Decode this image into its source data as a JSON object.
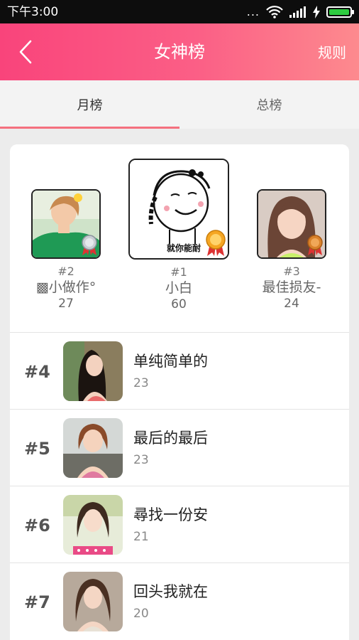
{
  "status_bar": {
    "time": "下午3:00",
    "dots": "...",
    "icons": [
      "wifi-icon",
      "signal-icon",
      "charging-icon",
      "battery-icon"
    ],
    "battery_level_percent": 100
  },
  "header": {
    "back_icon": "chevron-left-icon",
    "title": "女神榜",
    "rules_label": "规则"
  },
  "tabs": [
    {
      "label": "月榜",
      "active": true
    },
    {
      "label": "总榜",
      "active": false
    }
  ],
  "podium": [
    {
      "rank": "#2",
      "name": "▩小做作°",
      "score": "27",
      "medal": "silver-medal-icon"
    },
    {
      "rank": "#1",
      "name": "小白",
      "score": "60",
      "medal": "gold-medal-icon",
      "photo_caption": "就你能耐"
    },
    {
      "rank": "#3",
      "name": "最佳损友-",
      "score": "24",
      "medal": "bronze-medal-icon"
    }
  ],
  "list": [
    {
      "rank": "#4",
      "name": "单纯简单的",
      "score": "23"
    },
    {
      "rank": "#5",
      "name": "最后的最后",
      "score": "23"
    },
    {
      "rank": "#6",
      "name": "尋找一份安",
      "score": "21"
    },
    {
      "rank": "#7",
      "name": "回头我就在",
      "score": "20"
    }
  ],
  "colors": {
    "header_gradient_start": "#f9447b",
    "header_gradient_end": "#fd8a8e",
    "tab_indicator": "#f5707e",
    "page_background": "#ececec",
    "battery_green": "#2ecc40"
  }
}
